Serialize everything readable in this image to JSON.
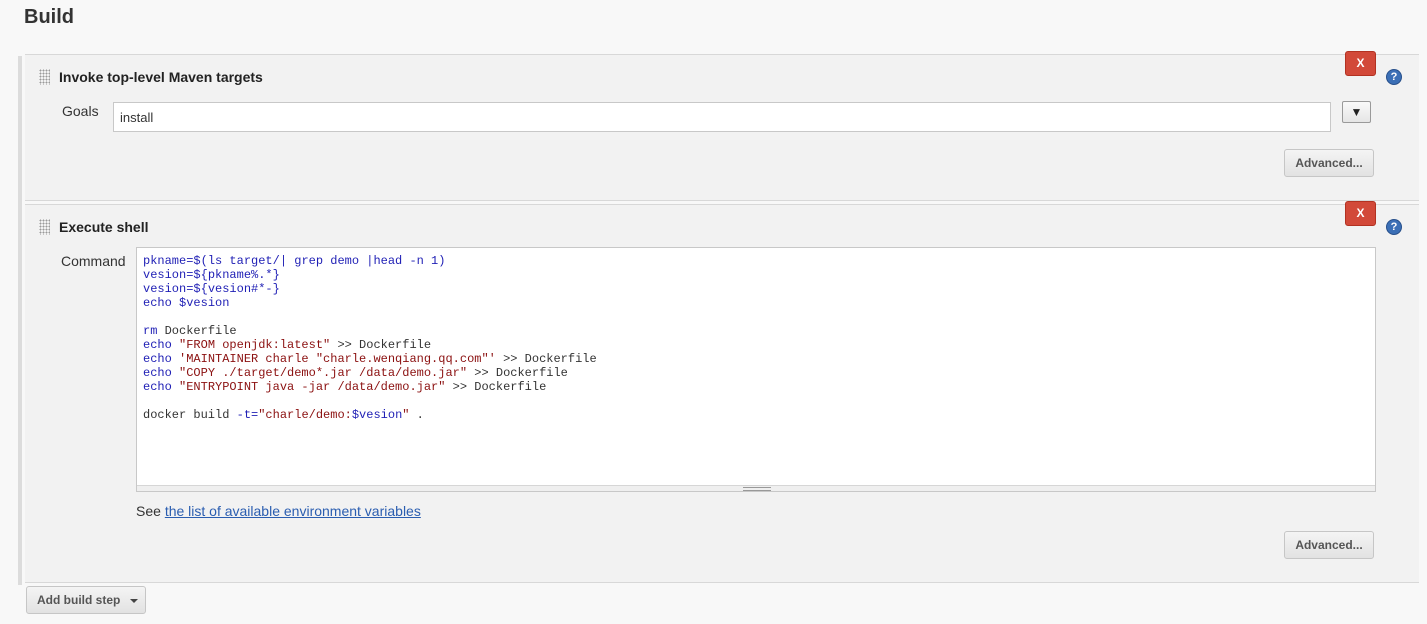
{
  "page": {
    "title": "Build"
  },
  "steps": [
    {
      "title": "Invoke top-level Maven targets",
      "delete_label": "X",
      "help_label": "?",
      "goals_label": "Goals",
      "goals_value": "install",
      "expand_label": "▼",
      "advanced_label": "Advanced..."
    },
    {
      "title": "Execute shell",
      "delete_label": "X",
      "help_label": "?",
      "command_label": "Command",
      "command_lines": [
        [
          {
            "t": "pkname=",
            "c": "cb"
          },
          {
            "t": "$(ls target/| grep demo |head -n 1)",
            "c": "cb"
          }
        ],
        [
          {
            "t": "vesion=",
            "c": "cb"
          },
          {
            "t": "${pkname%.*}",
            "c": "cb"
          }
        ],
        [
          {
            "t": "vesion=",
            "c": "cb"
          },
          {
            "t": "${vesion#*-}",
            "c": "cb"
          }
        ],
        [
          {
            "t": "echo ",
            "c": "cb"
          },
          {
            "t": "$vesion",
            "c": "cb"
          }
        ],
        [],
        [
          {
            "t": "rm ",
            "c": "cb"
          },
          {
            "t": "Dockerfile",
            "c": "cg"
          }
        ],
        [
          {
            "t": "echo ",
            "c": "cb"
          },
          {
            "t": "\"FROM openjdk:latest\"",
            "c": "cr"
          },
          {
            "t": " >> Dockerfile",
            "c": "cg"
          }
        ],
        [
          {
            "t": "echo ",
            "c": "cb"
          },
          {
            "t": "'MAINTAINER charle \"charle.wenqiang.qq.com\"'",
            "c": "cr"
          },
          {
            "t": " >> Dockerfile",
            "c": "cg"
          }
        ],
        [
          {
            "t": "echo ",
            "c": "cb"
          },
          {
            "t": "\"COPY ./target/demo*.jar /data/demo.jar\"",
            "c": "cr"
          },
          {
            "t": " >> Dockerfile",
            "c": "cg"
          }
        ],
        [
          {
            "t": "echo ",
            "c": "cb"
          },
          {
            "t": "\"ENTRYPOINT java -jar /data/demo.jar\"",
            "c": "cr"
          },
          {
            "t": " >> Dockerfile",
            "c": "cg"
          }
        ],
        [],
        [
          {
            "t": "docker build ",
            "c": "cg"
          },
          {
            "t": "-t=",
            "c": "cb"
          },
          {
            "t": "\"charle/demo:",
            "c": "cr"
          },
          {
            "t": "$vesion",
            "c": "cb"
          },
          {
            "t": "\"",
            "c": "cr"
          },
          {
            "t": " .",
            "c": "cg"
          }
        ]
      ],
      "env_prefix": "See ",
      "env_link": "the list of available environment variables",
      "advanced_label": "Advanced..."
    }
  ],
  "add_step_label": "Add build step",
  "colors": {
    "delete": "#d24939",
    "help": "#3b6fb6",
    "link": "#2a5db0",
    "code_blue": "#1f1fb5",
    "code_red": "#8b1010"
  }
}
